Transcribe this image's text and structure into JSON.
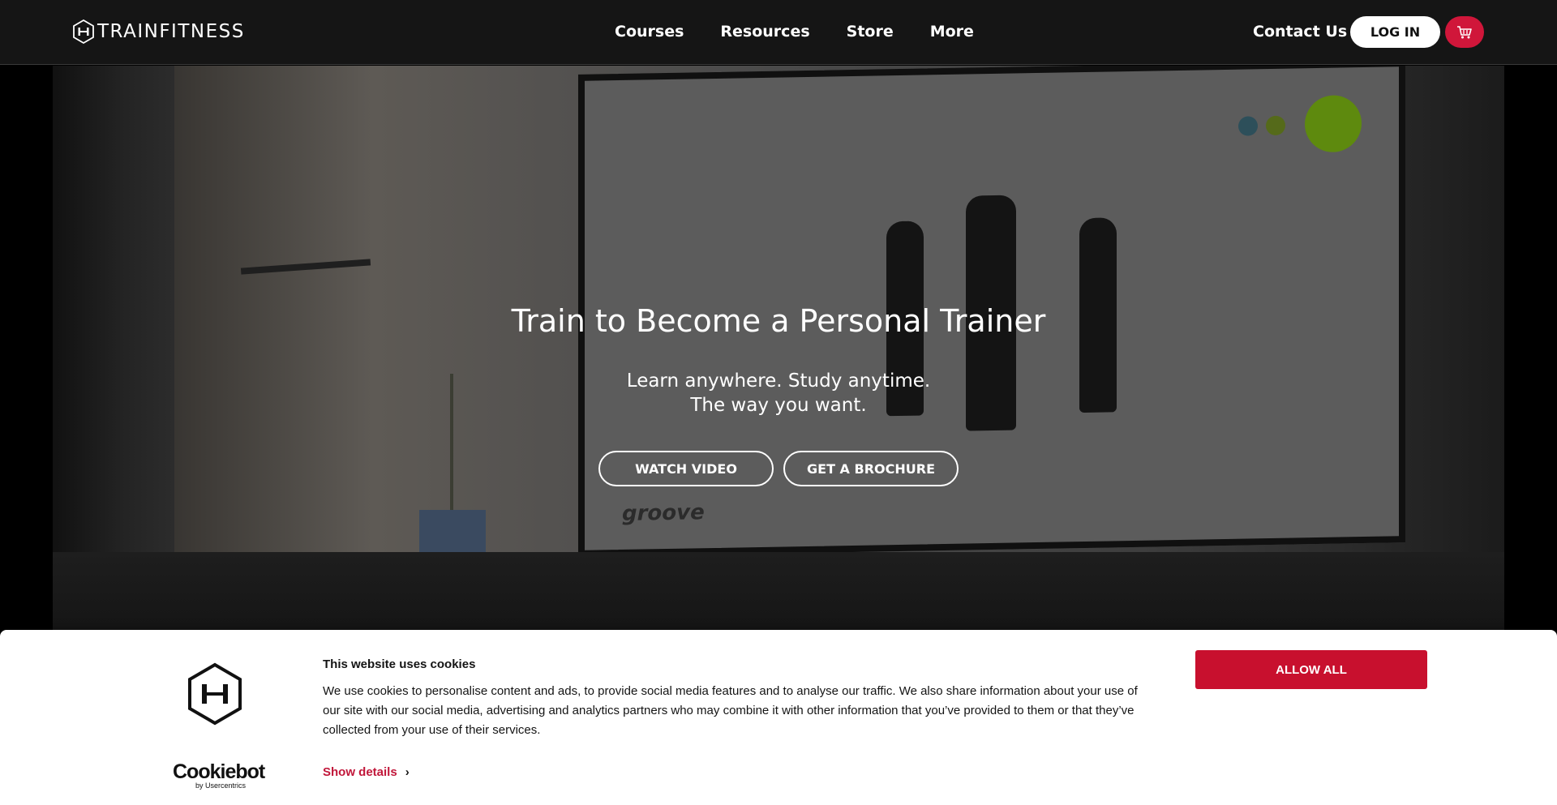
{
  "header": {
    "logo_text": "TRAINFITNESS",
    "nav": [
      "Courses",
      "Resources",
      "Store",
      "More"
    ],
    "contact_label": "Contact Us",
    "login_label": "LOG IN"
  },
  "hero": {
    "title": "Train to Become a Personal Trainer",
    "subtitle_line1": "Learn anywhere. Study anytime.",
    "subtitle_line2": "The way you want.",
    "watch_video_label": "WATCH VIDEO",
    "brochure_label": "GET A BROCHURE",
    "screen_brand": "groove"
  },
  "cookie_banner": {
    "title": "This website uses cookies",
    "text": "We use cookies to personalise content and ads, to provide social media features and to analyse our traffic. We also share information about your use of our site with our social media, advertising and analytics partners who may combine it with other information that you’ve provided to them or that they’ve collected from your use of their services.",
    "show_details_label": "Show details",
    "allow_all_label": "ALLOW ALL",
    "provider_name": "Cookiebot",
    "provider_by": "by Usercentrics"
  },
  "colors": {
    "header_bg": "#151515",
    "accent_red": "#c8102e",
    "cart_red": "#d0163a"
  },
  "icons": [
    "dumbbell-hexagon-icon",
    "cart-icon",
    "chevron-right-icon"
  ]
}
